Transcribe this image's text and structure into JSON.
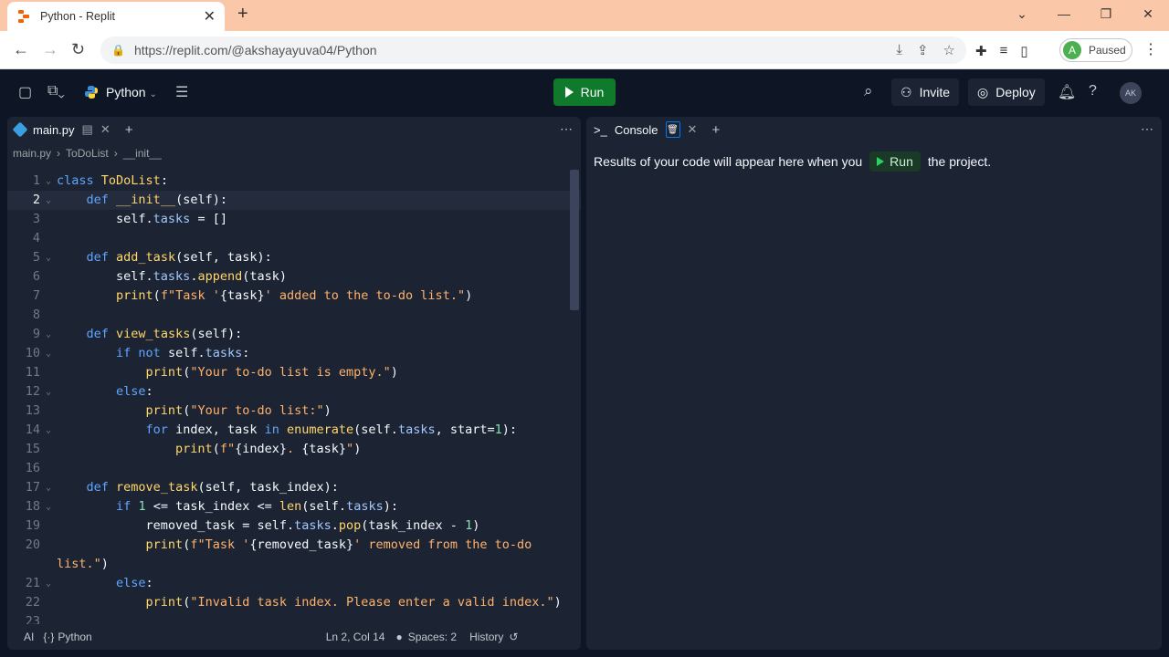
{
  "browser": {
    "tab_title": "Python - Replit",
    "url": "https://replit.com/@akshayayuva04/Python",
    "profile_initial": "A",
    "profile_status": "Paused"
  },
  "header": {
    "project_name": "Python",
    "run_label": "Run",
    "invite_label": "Invite",
    "deploy_label": "Deploy",
    "user_initials": "AK"
  },
  "editor": {
    "tab_name": "main.py",
    "breadcrumb": [
      "main.py",
      "ToDoList",
      "__init__"
    ],
    "lines": [
      {
        "n": "1",
        "fold": true,
        "html": "<span class='kw'>class</span> <span class='fn'>ToDoList</span>:"
      },
      {
        "n": "2",
        "fold": true,
        "active": true,
        "html": "    <span class='kw'>def</span> <span class='fn'>__init__</span>(self):"
      },
      {
        "n": "3",
        "fold": false,
        "html": "        self.<span class='at'>tasks</span> = []"
      },
      {
        "n": "4",
        "fold": false,
        "html": ""
      },
      {
        "n": "5",
        "fold": true,
        "html": "    <span class='kw'>def</span> <span class='fn'>add_task</span>(self, task):"
      },
      {
        "n": "6",
        "fold": false,
        "html": "        self.<span class='at'>tasks</span>.<span class='fn'>append</span>(task)"
      },
      {
        "n": "7",
        "fold": false,
        "html": "        <span class='bi'>print</span>(<span class='str'>f\"Task '</span>{task}<span class='str'>' added to the to-do list.\"</span>)"
      },
      {
        "n": "8",
        "fold": false,
        "html": ""
      },
      {
        "n": "9",
        "fold": true,
        "html": "    <span class='kw'>def</span> <span class='fn'>view_tasks</span>(self):"
      },
      {
        "n": "10",
        "fold": true,
        "html": "        <span class='kw'>if not</span> self.<span class='at'>tasks</span>:"
      },
      {
        "n": "11",
        "fold": false,
        "html": "            <span class='bi'>print</span>(<span class='str'>\"Your to-do list is empty.\"</span>)"
      },
      {
        "n": "12",
        "fold": true,
        "html": "        <span class='kw'>else</span>:"
      },
      {
        "n": "13",
        "fold": false,
        "html": "            <span class='bi'>print</span>(<span class='str'>\"Your to-do list:\"</span>)"
      },
      {
        "n": "14",
        "fold": true,
        "html": "            <span class='kw'>for</span> index, task <span class='kw'>in</span> <span class='bi'>enumerate</span>(self.<span class='at'>tasks</span>, start=<span class='num'>1</span>):"
      },
      {
        "n": "15",
        "fold": false,
        "html": "                <span class='bi'>print</span>(<span class='str'>f\"</span>{index}<span class='str'>. </span>{task}<span class='str'>\"</span>)"
      },
      {
        "n": "16",
        "fold": false,
        "html": ""
      },
      {
        "n": "17",
        "fold": true,
        "html": "    <span class='kw'>def</span> <span class='fn'>remove_task</span>(self, task_index):"
      },
      {
        "n": "18",
        "fold": true,
        "html": "        <span class='kw'>if</span> <span class='num'>1</span> <= task_index <= <span class='bi'>len</span>(self.<span class='at'>tasks</span>):"
      },
      {
        "n": "19",
        "fold": false,
        "html": "            removed_task = self.<span class='at'>tasks</span>.<span class='fn'>pop</span>(task_index - <span class='num'>1</span>)"
      },
      {
        "n": "20",
        "fold": false,
        "html": "            <span class='bi'>print</span>(<span class='str'>f\"Task '</span>{removed_task}<span class='str'>' removed from the to-do</span>"
      },
      {
        "n": "",
        "fold": false,
        "html": "<span class='str'>list.\"</span>)"
      },
      {
        "n": "21",
        "fold": true,
        "html": "        <span class='kw'>else</span>:"
      },
      {
        "n": "22",
        "fold": false,
        "html": "            <span class='bi'>print</span>(<span class='str'>\"Invalid task index. Please enter a valid index.\"</span>)"
      },
      {
        "n": "23",
        "fold": false,
        "html": ""
      }
    ],
    "status": {
      "ai": "AI",
      "language": "Python",
      "cursor": "Ln 2, Col 14",
      "spaces": "Spaces: 2",
      "history": "History"
    }
  },
  "console": {
    "tab_name": "Console",
    "msg_before": "Results of your code will appear here when you",
    "run_label": "Run",
    "msg_after": "the project."
  }
}
